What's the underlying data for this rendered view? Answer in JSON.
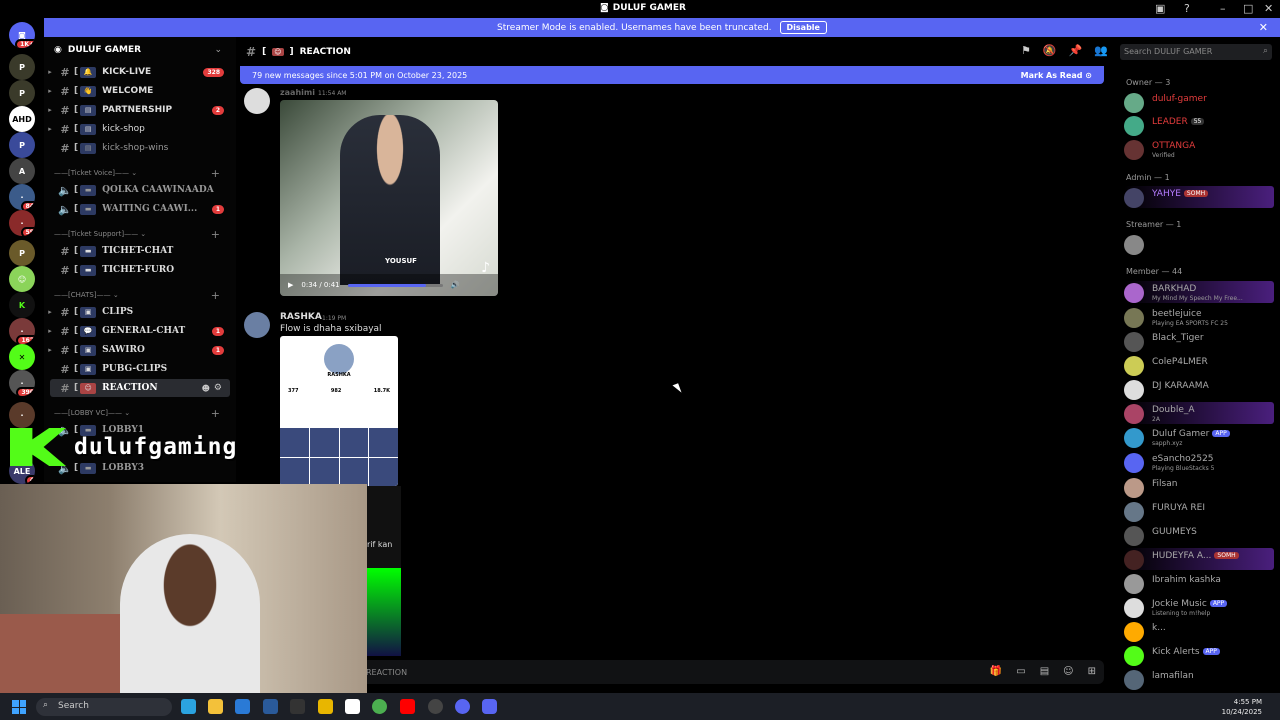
{
  "window": {
    "title": "DULUF GAMER"
  },
  "streamer_bar": {
    "text": "Streamer Mode is enabled. Usernames have been truncated.",
    "button": "Disable"
  },
  "server": {
    "name": "DULUF GAMER"
  },
  "rail": {
    "notif": "1K+",
    "badges": [
      "84",
      "59",
      "162",
      "390",
      "4"
    ],
    "labels": [
      "AHD",
      "ALE"
    ]
  },
  "channels": [
    {
      "name": "KICK-LIVE",
      "count": "328"
    },
    {
      "name": "WELCOME",
      "count": ""
    },
    {
      "name": "PARTNERSHIP",
      "count": "2"
    },
    {
      "name": "kick-shop",
      "count": ""
    },
    {
      "name": "kick-shop-wins",
      "count": ""
    },
    {
      "name": "QOLKA CAAWINAADA",
      "count": ""
    },
    {
      "name": "WAITING CAAWI...",
      "count": "1"
    },
    {
      "name": "TICHET-CHAT",
      "count": ""
    },
    {
      "name": "TICHET-FURO",
      "count": ""
    },
    {
      "name": "CLIPS",
      "count": ""
    },
    {
      "name": "GENERAL-CHAT",
      "count": "1"
    },
    {
      "name": "SAWIRO",
      "count": "1"
    },
    {
      "name": "PUBG-CLIPS",
      "count": ""
    },
    {
      "name": "REACTION",
      "count": ""
    },
    {
      "name": "LOBBY1",
      "count": ""
    },
    {
      "name": "LOBBY3",
      "count": ""
    }
  ],
  "categories": [
    "Ticket Voice",
    "Ticket Support",
    "CHATS",
    "LOBBY VC"
  ],
  "header": {
    "channel": "REACTION",
    "search_placeholder": "Search DULUF GAMER"
  },
  "new_messages": {
    "text": "79 new messages since 5:01 PM on October 23, 2025",
    "action": "Mark As Read"
  },
  "messages": [
    {
      "user": "zaahimi",
      "time": "11:54 AM",
      "text": ""
    },
    {
      "user": "RASHKA",
      "time": "1:19 PM",
      "text": "Flow is dhaha sxibayal"
    }
  ],
  "video": {
    "time": "0:34 / 0:41",
    "progress": 0.83,
    "watermark": "YOUSUF"
  },
  "profile": {
    "name": "RASHKA",
    "stats": [
      "377",
      "982",
      "18.7K"
    ]
  },
  "partial_text": "rif kan",
  "compose": {
    "placeholder": "REACTION"
  },
  "overlay": {
    "name": "dulufgaming"
  },
  "members": {
    "groups": [
      {
        "title": "Owner — 3"
      },
      {
        "title": "Admin — 1"
      },
      {
        "title": "Streamer — 1"
      },
      {
        "title": "Member — 44"
      }
    ],
    "list": [
      {
        "name": "duluf-gamer",
        "sub": "",
        "color": "#e23c3c"
      },
      {
        "name": "LEADER",
        "sub": "",
        "tag": "55",
        "color": "#e23c3c"
      },
      {
        "name": "OTTANGA",
        "sub": "Verified",
        "color": "#e23c3c"
      },
      {
        "name": "YAHYE",
        "sub": "",
        "tag": "SOMH",
        "color": "#b57cff"
      },
      {
        "name": "",
        "sub": "",
        "color": "#aaa"
      },
      {
        "name": "BARKHAD",
        "sub": "My Mind My Speech My Free...",
        "color": "#aaa"
      },
      {
        "name": "beetlejuice",
        "sub": "Playing EA SPORTS FC 25",
        "color": "#aaa"
      },
      {
        "name": "Black_Tiger",
        "sub": "",
        "color": "#aaa"
      },
      {
        "name": "ColeP4LMER",
        "sub": "",
        "color": "#aaa"
      },
      {
        "name": "DJ KARAAMA",
        "sub": "",
        "color": "#aaa"
      },
      {
        "name": "Double_A",
        "sub": "2A",
        "color": "#aaa"
      },
      {
        "name": "Duluf Gamer",
        "sub": "sapph.xyz",
        "tag": "APP",
        "color": "#aaa"
      },
      {
        "name": "eSancho2525",
        "sub": "Playing BlueStacks 5",
        "color": "#aaa"
      },
      {
        "name": "Filsan",
        "sub": "",
        "color": "#aaa"
      },
      {
        "name": "FURUYA REI",
        "sub": "",
        "color": "#aaa"
      },
      {
        "name": "GUUMEYS",
        "sub": "",
        "color": "#aaa"
      },
      {
        "name": "HUDEYFA A...",
        "sub": "",
        "tag": "SOMH",
        "color": "#aaa"
      },
      {
        "name": "Ibrahim kashka",
        "sub": "",
        "color": "#aaa"
      },
      {
        "name": "Jockie Music",
        "sub": "Listening to m!help",
        "tag": "APP",
        "color": "#aaa"
      },
      {
        "name": "k...",
        "sub": "",
        "color": "#aaa"
      },
      {
        "name": "Kick Alerts",
        "sub": "",
        "tag": "APP",
        "color": "#aaa"
      },
      {
        "name": "lamafilan",
        "sub": "",
        "color": "#aaa"
      }
    ]
  },
  "taskbar": {
    "search": "Search",
    "time": "4:55 PM",
    "date": "10/24/2025"
  },
  "colors": {
    "blurple": "#5865f2",
    "bg": "#000000",
    "red": "#e23c3c"
  }
}
